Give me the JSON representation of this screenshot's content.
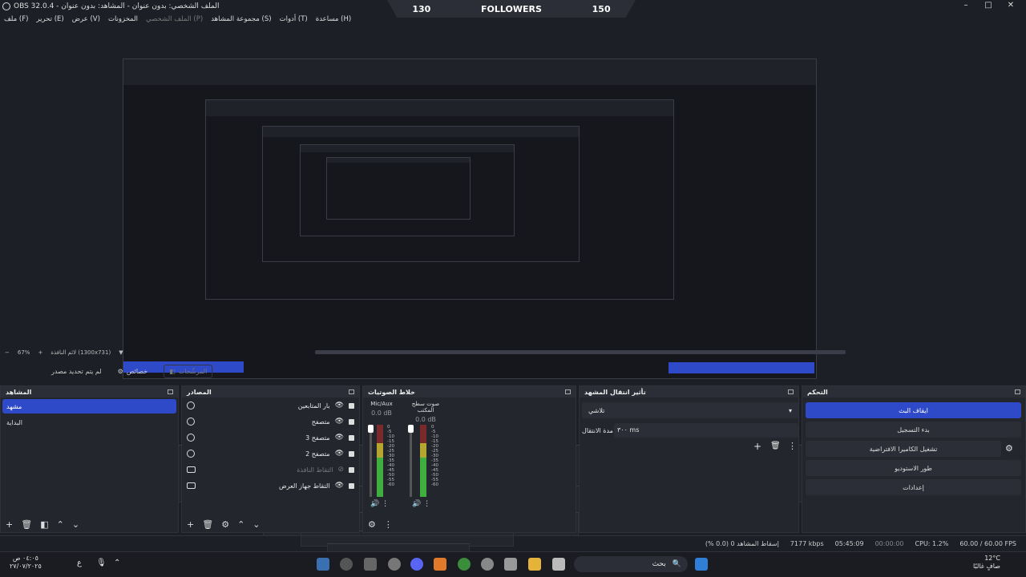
{
  "window": {
    "title": "OBS 32.0.4 - الملف الشخصي: بدون عنوان - المشاهد: بدون عنوان"
  },
  "overlay": {
    "left": "130",
    "center": "FOLLOWERS",
    "right": "150"
  },
  "window_controls": {
    "min": "–",
    "max": "□",
    "close": "✕"
  },
  "menu": [
    "ملف (F)",
    "تحرير (E)",
    "عرض (V)",
    "المخزونات",
    "الملف الشخصي (P)",
    "مجموعة المشاهد (S)",
    "أدوات (T)",
    "مساعدة (H)"
  ],
  "preview_status": {
    "zoom": "67%",
    "minus": "−",
    "plus": "+",
    "fit": "لائم النافذة (1300x731)",
    "arrow": "▼"
  },
  "controls_row": {
    "display_capture_msg": "لم يتم تحديد مصدر",
    "properties": "خصائص",
    "filters": "المرشّحات"
  },
  "scenes": {
    "title": "المشاهد",
    "items": [
      "مشهد",
      "البداية"
    ]
  },
  "sources": {
    "title": "المصادر",
    "items": [
      "بار المتابعين",
      "متصفح",
      "متصفح 3",
      "متصفح 2",
      "التقاط النافذة",
      "التقاط جهاز العرض"
    ]
  },
  "mixer": {
    "title": "خلاط الصوتيات",
    "channels": [
      {
        "name": "Mic/Aux",
        "db": "0.0 dB"
      },
      {
        "name": "صوت سطح المكتب",
        "db": "0.0 dB"
      }
    ],
    "scale": [
      "0",
      "-5",
      "-10",
      "-15",
      "-20",
      "-25",
      "-30",
      "-35",
      "-40",
      "-45",
      "-50",
      "-55",
      "-60"
    ]
  },
  "transitions": {
    "title": "تأثير انتقال المشهد",
    "selected": "تلاشي",
    "duration_label": "مدة الانتقال",
    "duration_value": "٣٠٠ ms"
  },
  "controls": {
    "title": "التحكم",
    "buttons": [
      "ايقاف البث",
      "بدء التسجيل",
      "تشغيل الكاميرا الافتراضية",
      "طور الاستوديو",
      "إعدادات"
    ]
  },
  "status": {
    "dropped": "إسقاط المشاهد 0 (0.0 %)",
    "bitrate": "7177 kbps",
    "stream_time": "05:45:09",
    "rec_time": "00:00:00",
    "cpu": "CPU: 1.2%",
    "fps": "60.00 / 60.00 FPS"
  },
  "taskbar": {
    "search": "بحث",
    "time": "٠٤:٠٥ ص",
    "date": "٢٧/٠٧/٢٠٢٥",
    "weather_temp": "12°C",
    "weather_desc": "صافٍ غالبًا",
    "lang": "ع"
  },
  "colors": {
    "accent": "#2f4ac9",
    "bg": "#1d1f26",
    "dock": "#24262e"
  }
}
